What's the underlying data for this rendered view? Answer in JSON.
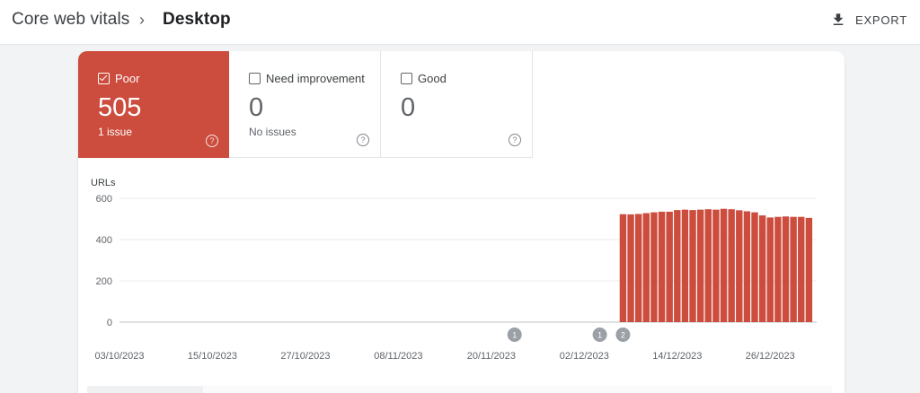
{
  "breadcrumb": {
    "parent": "Core web vitals",
    "separator": "›",
    "current": "Desktop"
  },
  "toolbar": {
    "export_label": "EXPORT",
    "export_icon": "download-icon"
  },
  "tiles": [
    {
      "key": "poor",
      "label": "Poor",
      "value": "505",
      "sub": "1 issue",
      "checked": true,
      "color": "#cc4c3d"
    },
    {
      "key": "needs",
      "label": "Need improvement",
      "value": "0",
      "sub": "No issues",
      "checked": false
    },
    {
      "key": "good",
      "label": "Good",
      "value": "0",
      "sub": "",
      "checked": false
    }
  ],
  "help_glyph": "?",
  "chart_data": {
    "type": "bar",
    "ylabel": "URLs",
    "ylim": [
      0,
      600
    ],
    "yticks": [
      0,
      200,
      400,
      600
    ],
    "grid": true,
    "bar_color": "#cc4c3d",
    "x_start": "03/10/2023",
    "x_end": "01/01/2024",
    "xtick_labels": [
      "03/10/2023",
      "15/10/2023",
      "27/10/2023",
      "08/11/2023",
      "20/11/2023",
      "02/12/2023",
      "14/12/2023",
      "26/12/2023"
    ],
    "x": [
      "07/12/2023",
      "08/12/2023",
      "09/12/2023",
      "10/12/2023",
      "11/12/2023",
      "12/12/2023",
      "13/12/2023",
      "14/12/2023",
      "15/12/2023",
      "16/12/2023",
      "17/12/2023",
      "18/12/2023",
      "19/12/2023",
      "20/12/2023",
      "21/12/2023",
      "22/12/2023",
      "23/12/2023",
      "24/12/2023",
      "25/12/2023",
      "26/12/2023",
      "27/12/2023",
      "28/12/2023",
      "29/12/2023",
      "30/12/2023",
      "31/12/2023"
    ],
    "values": [
      523,
      522,
      524,
      528,
      532,
      535,
      535,
      543,
      545,
      543,
      545,
      547,
      545,
      549,
      547,
      542,
      537,
      532,
      517,
      507,
      510,
      512,
      510,
      510,
      505
    ],
    "annotations": [
      {
        "date": "23/11/2023",
        "label": "1"
      },
      {
        "date": "04/12/2023",
        "label": "1"
      },
      {
        "date": "07/12/2023",
        "label": "2"
      }
    ]
  }
}
